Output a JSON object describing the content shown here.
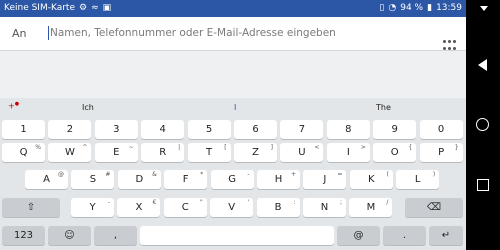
{
  "status_bar": {
    "carrier": "Keine SIM-Karte",
    "battery": "94 %",
    "time": "13:59"
  },
  "compose": {
    "to_label": "An",
    "to_placeholder": "Namen, Telefonnummer oder E-Mail-Adresse eingeben"
  },
  "suggestions": [
    "Ich",
    "I",
    "The"
  ],
  "keyboard": {
    "numbers": [
      "1",
      "2",
      "3",
      "4",
      "5",
      "6",
      "7",
      "8",
      "9",
      "0"
    ],
    "row1": [
      {
        "main": "Q",
        "sec": "%"
      },
      {
        "main": "W",
        "sec": "^"
      },
      {
        "main": "E",
        "sec": "~"
      },
      {
        "main": "R",
        "sec": "|"
      },
      {
        "main": "T",
        "sec": "["
      },
      {
        "main": "Z",
        "sec": "]"
      },
      {
        "main": "U",
        "sec": "<"
      },
      {
        "main": "I",
        "sec": ">"
      },
      {
        "main": "O",
        "sec": "{"
      },
      {
        "main": "P",
        "sec": "}"
      }
    ],
    "row2": [
      {
        "main": "A",
        "sec": "@"
      },
      {
        "main": "S",
        "sec": "#"
      },
      {
        "main": "D",
        "sec": "&"
      },
      {
        "main": "F",
        "sec": "*"
      },
      {
        "main": "G",
        "sec": "-"
      },
      {
        "main": "H",
        "sec": "+"
      },
      {
        "main": "J",
        "sec": "="
      },
      {
        "main": "K",
        "sec": "("
      },
      {
        "main": "L",
        "sec": ")"
      }
    ],
    "row3": [
      {
        "main": "Y",
        "sec": "-"
      },
      {
        "main": "X",
        "sec": "€"
      },
      {
        "main": "C",
        "sec": "\""
      },
      {
        "main": "V",
        "sec": "'"
      },
      {
        "main": "B",
        "sec": ":"
      },
      {
        "main": "N",
        "sec": ";"
      },
      {
        "main": "M",
        "sec": "/"
      }
    ],
    "bottom": {
      "num_label": "123",
      "at_label": "@",
      "dotcom_label": ".",
      "comma_label": ","
    }
  },
  "icons": {
    "shift": "shift-icon",
    "backspace": "backspace-icon",
    "emoji": "emoji-icon",
    "mic": "microphone-icon",
    "enter": "enter-icon"
  }
}
